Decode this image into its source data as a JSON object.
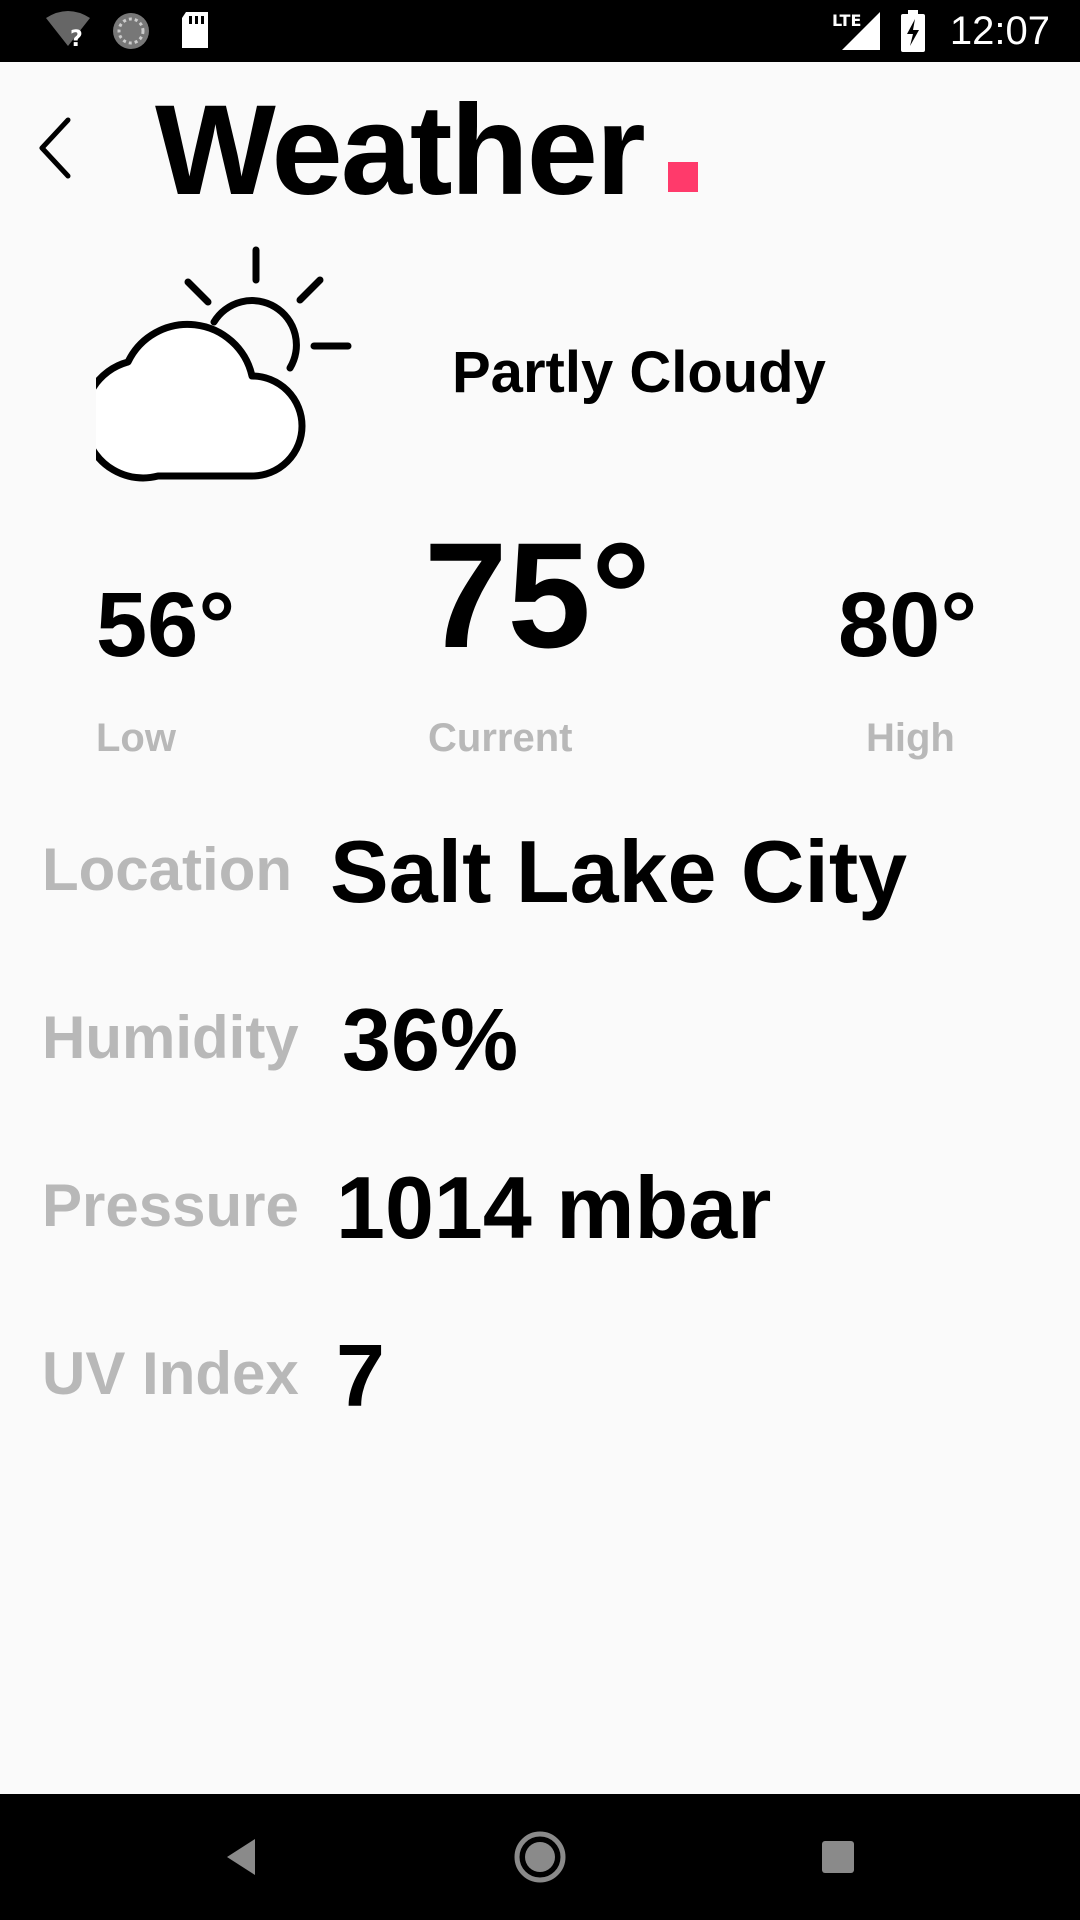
{
  "status_bar": {
    "time": "12:07",
    "network_label": "LTE",
    "icons": [
      "wifi-unknown-icon",
      "sync-icon",
      "sd-card-icon",
      "cell-signal-icon",
      "battery-charging-icon"
    ]
  },
  "header": {
    "title": "Weather",
    "accent_color": "#ff3a6b"
  },
  "condition": {
    "icon": "partly-cloudy-icon",
    "text": "Partly Cloudy"
  },
  "temperatures": {
    "low": {
      "value": "56°",
      "label": "Low"
    },
    "current": {
      "value": "75°",
      "label": "Current"
    },
    "high": {
      "value": "80°",
      "label": "High"
    }
  },
  "details": {
    "location": {
      "label": "Location",
      "value": "Salt Lake City"
    },
    "humidity": {
      "label": "Humidity",
      "value": "36%"
    },
    "pressure": {
      "label": "Pressure",
      "value": "1014 mbar"
    },
    "uv_index": {
      "label": "UV Index",
      "value": "7"
    }
  },
  "colors": {
    "label_gray": "#b8b8b8",
    "background": "#fafafa"
  },
  "nav_bar": {
    "buttons": [
      "back-icon",
      "home-icon",
      "recents-icon"
    ]
  }
}
